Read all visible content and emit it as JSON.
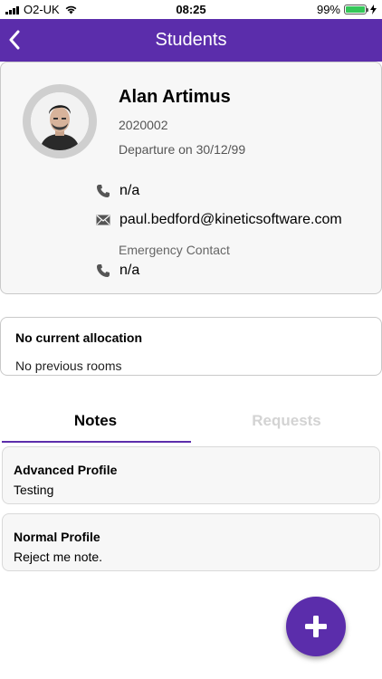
{
  "status_bar": {
    "carrier": "O2-UK",
    "time": "08:25",
    "battery_percent": "99%",
    "battery_level": 0.99,
    "icons": [
      "signal-icon",
      "wifi-icon",
      "battery-icon",
      "charging-icon"
    ]
  },
  "header": {
    "title": "Students",
    "back_icon": "chevron-left-icon",
    "background": "#5b2dab"
  },
  "profile": {
    "name": "Alan Artimus",
    "student_id": "2020002",
    "departure": "Departure on 30/12/99",
    "phone": "n/a",
    "email": "paul.bedford@kineticsoftware.com",
    "emergency_label": "Emergency Contact",
    "emergency_phone": "n/a"
  },
  "allocation": {
    "title": "No current allocation",
    "subtitle": "No previous rooms"
  },
  "tabs": [
    {
      "label": "Notes",
      "active": true
    },
    {
      "label": "Requests",
      "active": false
    }
  ],
  "notes": [
    {
      "title": "Advanced Profile",
      "body": "Testing"
    },
    {
      "title": "Normal Profile",
      "body": "Reject me note."
    }
  ],
  "fab": {
    "icon": "plus-icon"
  },
  "colors": {
    "accent": "#5b2dab",
    "battery": "#34c759",
    "inactive_tab": "#d3d3d3"
  }
}
